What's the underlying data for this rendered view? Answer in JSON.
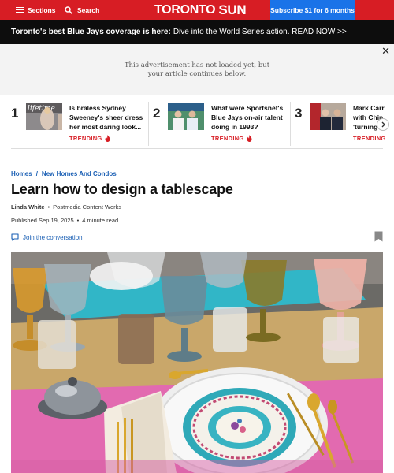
{
  "header": {
    "sections_label": "Sections",
    "search_label": "Search",
    "logo_toronto": "TORONTO",
    "logo_sun": "SUN",
    "subscribe_label": "Subscribe $1 for 6 months",
    "brand_color": "#d71d24",
    "subscribe_color": "#1a73e8"
  },
  "promo": {
    "bold_text": "Toronto's best Blue Jays coverage is here:",
    "text": "Dive into the World Series action. READ NOW >>"
  },
  "ad": {
    "line1": "This advertisement has not loaded yet, but",
    "line2": "your article continues below."
  },
  "trending": {
    "badge_label": "TRENDING",
    "items": [
      {
        "rank": "1",
        "line1": "Is braless Sydney",
        "line2": "Sweeney's sheer dress",
        "line3": "her most daring look..."
      },
      {
        "rank": "2",
        "line1": "What were Sportsnet's",
        "line2": "Blue Jays on-air talent",
        "line3": "doing in 1993?"
      },
      {
        "rank": "3",
        "line1": "Mark Carr",
        "line2": "with Chin",
        "line3": "'turning"
      }
    ]
  },
  "article": {
    "breadcrumb": [
      "Homes",
      "New Homes And Condos"
    ],
    "breadcrumb_sep": "/",
    "headline": "Learn how to design a tablescape",
    "author": "Linda White",
    "publisher": "Postmedia Content Works",
    "published": "Published Sep 19, 2025",
    "read_time": "4 minute read",
    "join_label": "Join the conversation",
    "dot": "•"
  },
  "icons": {
    "menu": "hamburger-icon",
    "search": "search-icon",
    "close": "close-icon",
    "trending": "flame-icon",
    "next": "chevron-right-icon",
    "comment": "chat-bubble-icon",
    "bookmark": "bookmark-icon"
  }
}
